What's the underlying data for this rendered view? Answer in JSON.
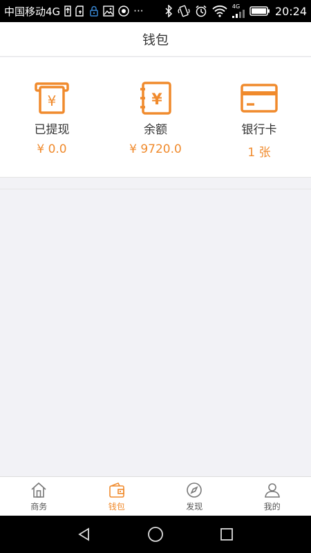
{
  "status_bar": {
    "carrier": "中国移动4G",
    "more": "···",
    "network": "4G",
    "time": "20:24"
  },
  "header": {
    "title": "钱包"
  },
  "wallet": {
    "items": [
      {
        "label": "已提现",
        "value": "¥ 0.0",
        "icon": "withdraw-icon"
      },
      {
        "label": "余额",
        "value": "¥ 9720.0",
        "icon": "balance-icon"
      },
      {
        "label": "银行卡",
        "value": "1 张",
        "icon": "bank-card-icon"
      }
    ]
  },
  "tabs": [
    {
      "label": "商务",
      "icon": "home-icon",
      "active": false
    },
    {
      "label": "钱包",
      "icon": "wallet-icon",
      "active": true
    },
    {
      "label": "发现",
      "icon": "compass-icon",
      "active": false
    },
    {
      "label": "我的",
      "icon": "user-icon",
      "active": false
    }
  ],
  "colors": {
    "accent": "#f08a2c",
    "background": "#f2f2f6"
  }
}
